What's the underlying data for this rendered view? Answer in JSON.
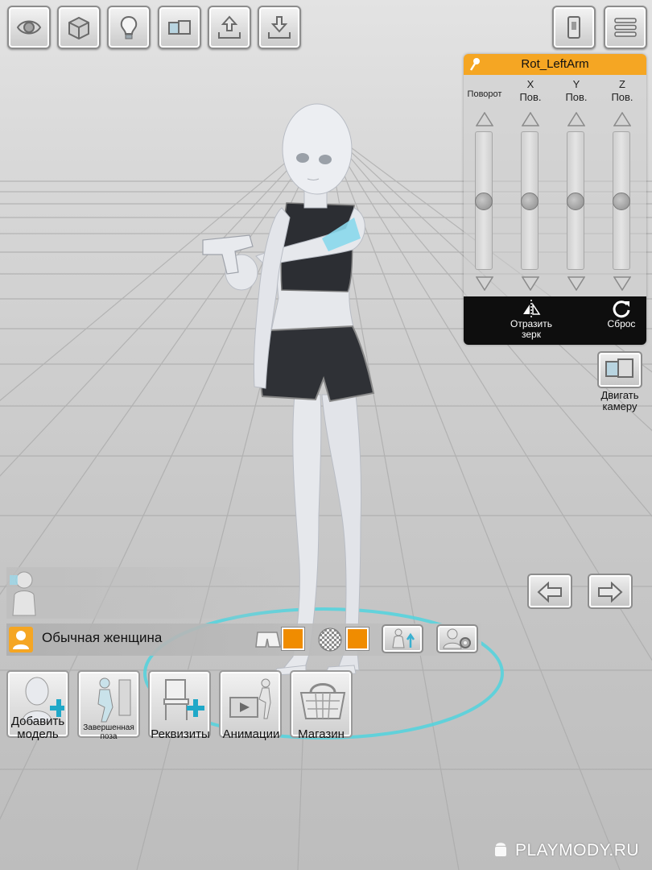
{
  "toolbar": {
    "buttons": [
      {
        "name": "eye-view-button",
        "icon": "eye-icon"
      },
      {
        "name": "cube-button",
        "icon": "cube-icon"
      },
      {
        "name": "light-button",
        "icon": "lightbulb-icon"
      },
      {
        "name": "camera-move-button",
        "icon": "camera-move-icon"
      },
      {
        "name": "upload-button",
        "icon": "upload-icon"
      },
      {
        "name": "download-button",
        "icon": "download-icon"
      }
    ],
    "right_buttons": [
      {
        "name": "phone-button",
        "icon": "phone-icon"
      },
      {
        "name": "menu-button",
        "icon": "menu-icon"
      }
    ]
  },
  "rotation_panel": {
    "title": "Rot_LeftArm",
    "columns": [
      {
        "top": "",
        "bottom": "Поворот"
      },
      {
        "top": "X",
        "bottom": "Пов."
      },
      {
        "top": "Y",
        "bottom": "Пов."
      },
      {
        "top": "Z",
        "bottom": "Пов."
      }
    ],
    "slider_levels": [
      0.5,
      0.5,
      0.5,
      0.5
    ],
    "mirror_label_1": "Отразить",
    "mirror_label_2": "зерк",
    "reset_label": "Сброс",
    "accent": "#f5a623"
  },
  "side": {
    "move_camera_1": "Двигать",
    "move_camera_2": "камеру"
  },
  "model_bar": {
    "name": "Обычная женщина",
    "swatch_color": "#f08c00"
  },
  "bottom": {
    "add_model_1": "Добавить",
    "add_model_2": "модель",
    "finished_pose_1": "Завершенная",
    "finished_pose_2": "поза",
    "props": "Реквизиты",
    "animations": "Анимации",
    "shop": "Магазин"
  },
  "watermark": "PLAYMODY.RU"
}
